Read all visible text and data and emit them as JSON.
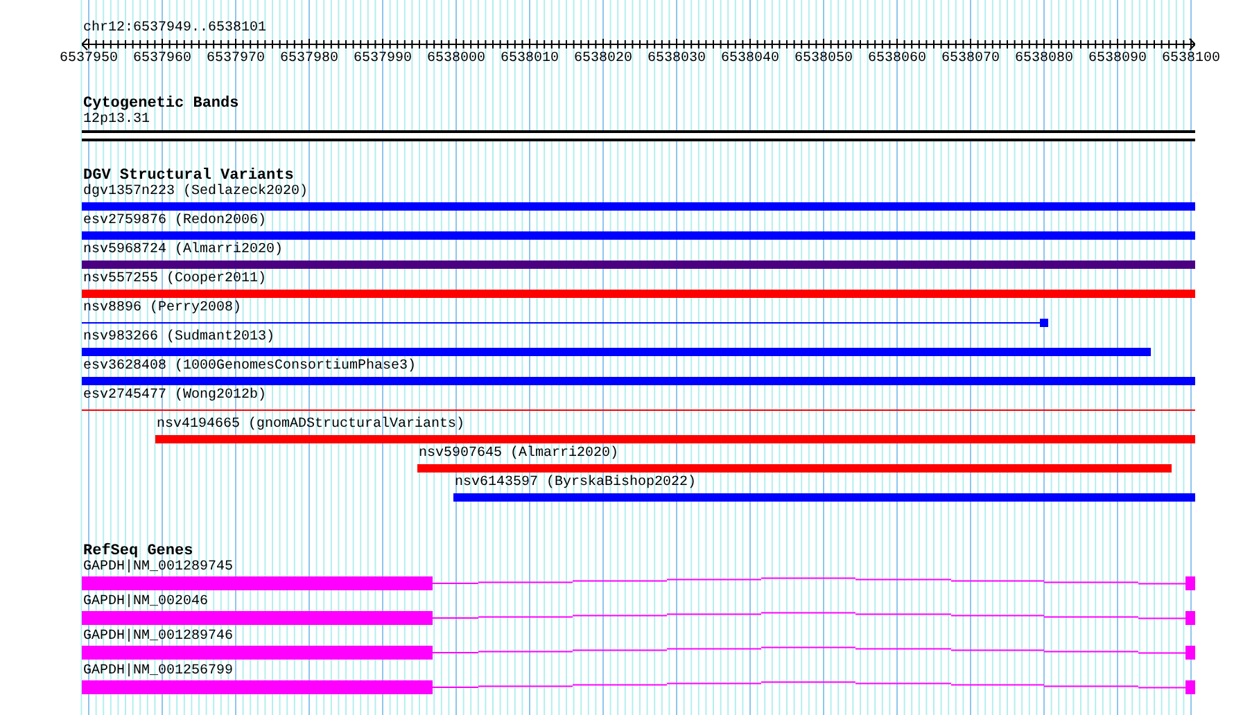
{
  "ruler": {
    "position": "chr12:6537949..6538101",
    "tick_labels": [
      "6537950",
      "6537960",
      "6537970",
      "6537980",
      "6537990",
      "6538000",
      "6538010",
      "6538020",
      "6538030",
      "6538040",
      "6538050",
      "6538060",
      "6538070",
      "6538080",
      "6538090",
      "6538100"
    ]
  },
  "tracks": [
    {
      "kind": "bands",
      "title": "Cytogenetic Bands",
      "items": [
        {
          "label": "12p13.31"
        }
      ]
    },
    {
      "kind": "variants",
      "title": "DGV Structural Variants",
      "items": [
        {
          "label": "dgv1357n223 (Sedlazeck2020)",
          "kind": "block",
          "color": "#0000ff"
        },
        {
          "label": "esv2759876 (Redon2006)",
          "kind": "block",
          "color": "#0000ff"
        },
        {
          "label": "nsv5968724 (Almarri2020)",
          "kind": "block",
          "color": "#4b0082"
        },
        {
          "label": "nsv557255 (Cooper2011)",
          "kind": "block",
          "color": "#ff0000"
        },
        {
          "label": "nsv8896 (Perry2008)",
          "kind": "line",
          "color": "#0000ff"
        },
        {
          "label": "nsv983266 (Sudmant2013)",
          "kind": "block",
          "color": "#0000ff"
        },
        {
          "label": "esv3628408 (1000GenomesConsortiumPhase3)",
          "kind": "block",
          "color": "#0000ff"
        },
        {
          "label": "esv2745477 (Wong2012b)",
          "kind": "line",
          "color": "#ff0000"
        },
        {
          "label": "nsv4194665 (gnomADStructuralVariants)",
          "kind": "block",
          "color": "#ff0000"
        },
        {
          "label": "nsv5907645 (Almarri2020)",
          "kind": "block",
          "color": "#ff0000"
        },
        {
          "label": "nsv6143597 (ByrskaBishop2022)",
          "kind": "block",
          "color": "#0000ff"
        }
      ]
    },
    {
      "kind": "genes",
      "title": "RefSeq Genes",
      "items": [
        {
          "label": "GAPDH|NM_001289745"
        },
        {
          "label": "GAPDH|NM_002046"
        },
        {
          "label": "GAPDH|NM_001289746"
        },
        {
          "label": "GAPDH|NM_001256799"
        }
      ]
    }
  ]
}
